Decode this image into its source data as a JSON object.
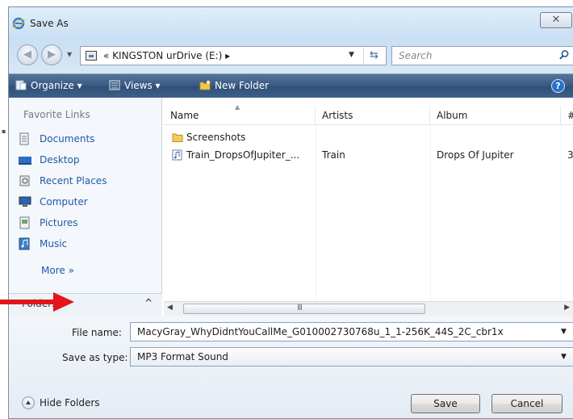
{
  "window": {
    "title": "Save As",
    "close_label": "✕"
  },
  "address": {
    "path": "« KINGSTON urDrive (E:) ▸",
    "search_placeholder": "Search"
  },
  "toolbar": {
    "organize": "Organize ▾",
    "views": "Views ▾",
    "new_folder": "New Folder",
    "help": "?"
  },
  "sidebar": {
    "title": "Favorite Links",
    "items": [
      {
        "label": "Documents",
        "icon": "documents-icon"
      },
      {
        "label": "Desktop",
        "icon": "desktop-icon"
      },
      {
        "label": "Recent Places",
        "icon": "recent-places-icon"
      },
      {
        "label": "Computer",
        "icon": "computer-icon"
      },
      {
        "label": "Pictures",
        "icon": "pictures-icon"
      },
      {
        "label": "Music",
        "icon": "music-icon"
      }
    ],
    "more": "More »",
    "folders_label": "Folders",
    "folders_toggle": "^"
  },
  "files": {
    "columns": [
      "Name",
      "Artists",
      "Album",
      "#"
    ],
    "rows": [
      {
        "name": "Screenshots",
        "artists": "",
        "album": "",
        "num": "",
        "type": "folder"
      },
      {
        "name": "Train_DropsOfJupiter_...",
        "artists": "Train",
        "album": "Drops Of Jupiter",
        "num": "3",
        "type": "audio"
      }
    ],
    "scroll_grip": "III"
  },
  "form": {
    "filename_label": "File name:",
    "filename_value": "MacyGray_WhyDidntYouCallMe_G010002730768u_1_1-256K_44S_2C_cbr1x",
    "savetype_label": "Save as type:",
    "savetype_value": "MP3 Format Sound",
    "hide_folders": "Hide Folders",
    "save": "Save",
    "cancel": "Cancel"
  },
  "colors": {
    "toolbar": "#3a5a82",
    "link": "#1f5aa8",
    "annotation_arrow": "#e3161b"
  }
}
